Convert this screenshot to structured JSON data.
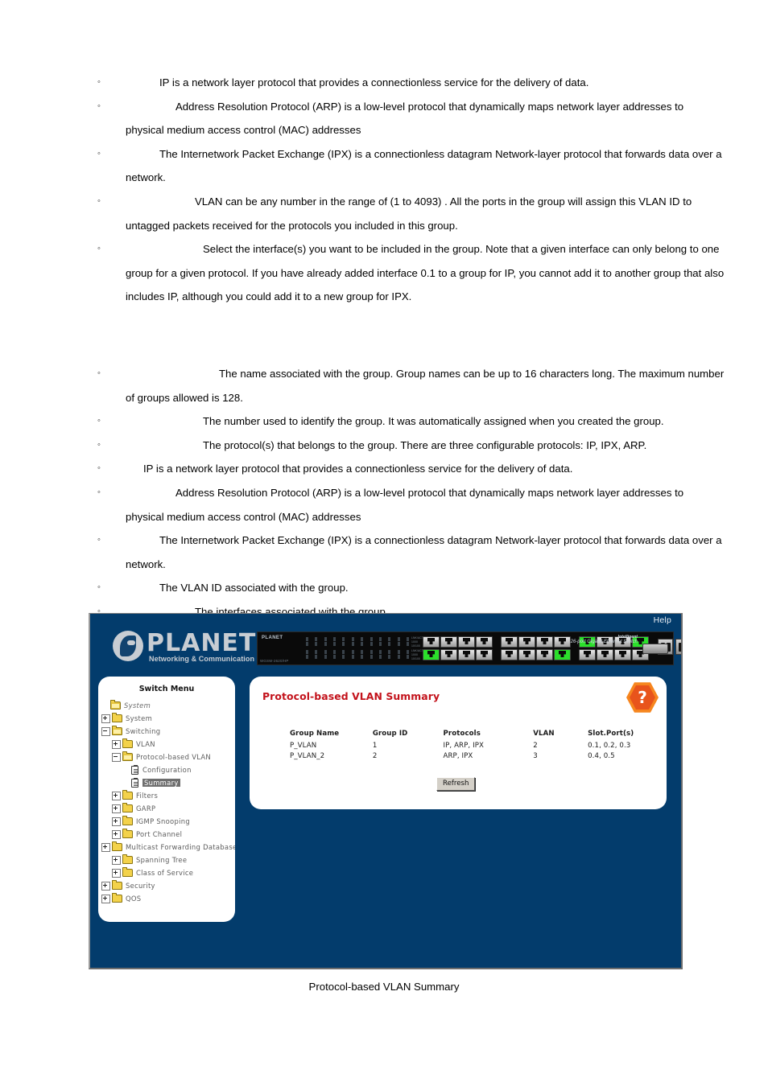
{
  "document": {
    "section_one": [
      {
        "indent": "ind-2",
        "text": "IP is a network layer protocol that provides a connectionless service for the delivery of data."
      },
      {
        "indent": "ind-3",
        "text": "Address Resolution Protocol (ARP) is a low-level protocol that dynamically maps network layer addresses to physical medium access control (MAC) addresses"
      },
      {
        "indent": "ind-2",
        "text": "The Internetwork Packet Exchange (IPX) is a connectionless datagram Network-layer protocol that forwards data over a network."
      },
      {
        "indent": "ind-4",
        "text": "VLAN can be any number in the range of (1 to 4093) . All the ports in the group will assign this VLAN ID to untagged packets received for the protocols you included in this group."
      },
      {
        "indent": "ind-5",
        "text": "Select the interface(s) you want to be included in the group. Note that a given interface can only belong to one group for a given protocol. If you have already added interface 0.1 to a group for IP, you cannot add it to another group that also includes IP, although you could add it to a new group for IPX."
      }
    ],
    "section_two": [
      {
        "indent": "ind-6",
        "text": "The name associated with the group. Group names can be up to 16 characters long. The maximum number of groups allowed is 128."
      },
      {
        "indent": "ind-5",
        "text": "The number used to identify the group. It was automatically assigned when you created the group."
      },
      {
        "indent": "ind-5",
        "text": "The protocol(s) that belongs to the group. There are three configurable protocols: IP, IPX, ARP."
      },
      {
        "indent": "ind-1",
        "text": "IP is a network layer protocol that provides a connectionless service for the delivery of data."
      },
      {
        "indent": "ind-3",
        "text": "Address Resolution Protocol (ARP) is a low-level protocol that dynamically maps network layer addresses to physical medium access control (MAC) addresses"
      },
      {
        "indent": "ind-2",
        "text": "The Internetwork Packet Exchange (IPX) is a connectionless datagram Network-layer protocol that forwards data over a network."
      },
      {
        "indent": "ind-2",
        "text": "The VLAN ID associated with the group."
      },
      {
        "indent": "ind-4",
        "text": "The interfaces associated with the group."
      }
    ],
    "bullet_glyph": "◦",
    "figure_caption": "Protocol-based VLAN Summary"
  },
  "screenshot": {
    "colors": {
      "page_background": "#033c6c",
      "panel_background": "#ffffff",
      "title_red": "#c3121b",
      "help_orange": "#f6861f",
      "help_orange_dark": "#e8541c",
      "logo_grey": "#c8cdd3",
      "selected_highlight": "#6e6e6e"
    },
    "header": {
      "help_link": "Help",
      "logo_name": "PLANET",
      "logo_tagline": "Networking & Communication",
      "logo_icon": "planet-globe-icon"
    },
    "device": {
      "brand": "PLANET",
      "model": "WGSW-2620/HP",
      "product_line": "Intelligent",
      "product_desc": "26-port Gigabit Ethernet Switch",
      "sfp_label": "MINI GBIC",
      "console_label": "CONSOLE",
      "led_labels_top": [
        "LNK/ACT",
        "1000",
        "10/100"
      ],
      "led_labels_bottom": [
        "LNK/ACT",
        "1000",
        "10/100"
      ],
      "port_numbers_top": [
        "1",
        "3",
        "5",
        "7",
        "9",
        "11",
        "13",
        "15",
        "17",
        "19",
        "21",
        "23"
      ],
      "port_numbers_bottom": [
        "2",
        "4",
        "6",
        "8",
        "10",
        "12",
        "14",
        "16",
        "18",
        "20",
        "22",
        "24"
      ],
      "lit_ports": [
        "group1-bottom-1",
        "group2-bottom-4",
        "group3-top-1",
        "group3-top-4"
      ]
    },
    "sidebar": {
      "title": "Switch Menu",
      "nodes": [
        {
          "depth": 0,
          "toggle": "none",
          "icon": "folder-open-icon",
          "label": "System",
          "state": "root"
        },
        {
          "depth": 0,
          "toggle": "plus",
          "icon": "folder-icon",
          "label": "System",
          "state": "normal"
        },
        {
          "depth": 0,
          "toggle": "minus",
          "icon": "folder-open-icon",
          "label": "Switching",
          "state": "normal"
        },
        {
          "depth": 1,
          "toggle": "plus",
          "icon": "folder-icon",
          "label": "VLAN",
          "state": "normal"
        },
        {
          "depth": 1,
          "toggle": "minus",
          "icon": "folder-open-icon",
          "label": "Protocol-based VLAN",
          "state": "normal"
        },
        {
          "depth": 2,
          "toggle": "none",
          "icon": "page-icon",
          "label": "Configuration",
          "state": "normal"
        },
        {
          "depth": 2,
          "toggle": "none",
          "icon": "page-icon",
          "label": "Summary",
          "state": "selected"
        },
        {
          "depth": 1,
          "toggle": "plus",
          "icon": "folder-icon",
          "label": "Filters",
          "state": "normal"
        },
        {
          "depth": 1,
          "toggle": "plus",
          "icon": "folder-icon",
          "label": "GARP",
          "state": "normal"
        },
        {
          "depth": 1,
          "toggle": "plus",
          "icon": "folder-icon",
          "label": "IGMP Snooping",
          "state": "normal"
        },
        {
          "depth": 1,
          "toggle": "plus",
          "icon": "folder-icon",
          "label": "Port Channel",
          "state": "normal"
        },
        {
          "depth": 1,
          "toggle": "plus",
          "icon": "folder-icon",
          "label": "Multicast Forwarding Database",
          "state": "normal"
        },
        {
          "depth": 1,
          "toggle": "plus",
          "icon": "folder-icon",
          "label": "Spanning Tree",
          "state": "normal"
        },
        {
          "depth": 1,
          "toggle": "plus",
          "icon": "folder-icon",
          "label": "Class of Service",
          "state": "normal"
        },
        {
          "depth": 0,
          "toggle": "plus",
          "icon": "folder-icon",
          "label": "Security",
          "state": "normal"
        },
        {
          "depth": 0,
          "toggle": "plus",
          "icon": "folder-icon",
          "label": "QOS",
          "state": "normal"
        }
      ]
    },
    "content": {
      "title": "Protocol-based VLAN Summary",
      "help_icon": "question-mark-hexagon-icon",
      "refresh_label": "Refresh",
      "table": {
        "headers": [
          "Group Name",
          "Group ID",
          "Protocols",
          "VLAN",
          "Slot.Port(s)"
        ],
        "rows": [
          [
            "P_VLAN",
            "1",
            "IP, ARP, IPX",
            "2",
            "0.1, 0.2, 0.3"
          ],
          [
            "P_VLAN_2",
            "2",
            "ARP, IPX",
            "3",
            "0.4, 0.5"
          ]
        ]
      }
    }
  }
}
